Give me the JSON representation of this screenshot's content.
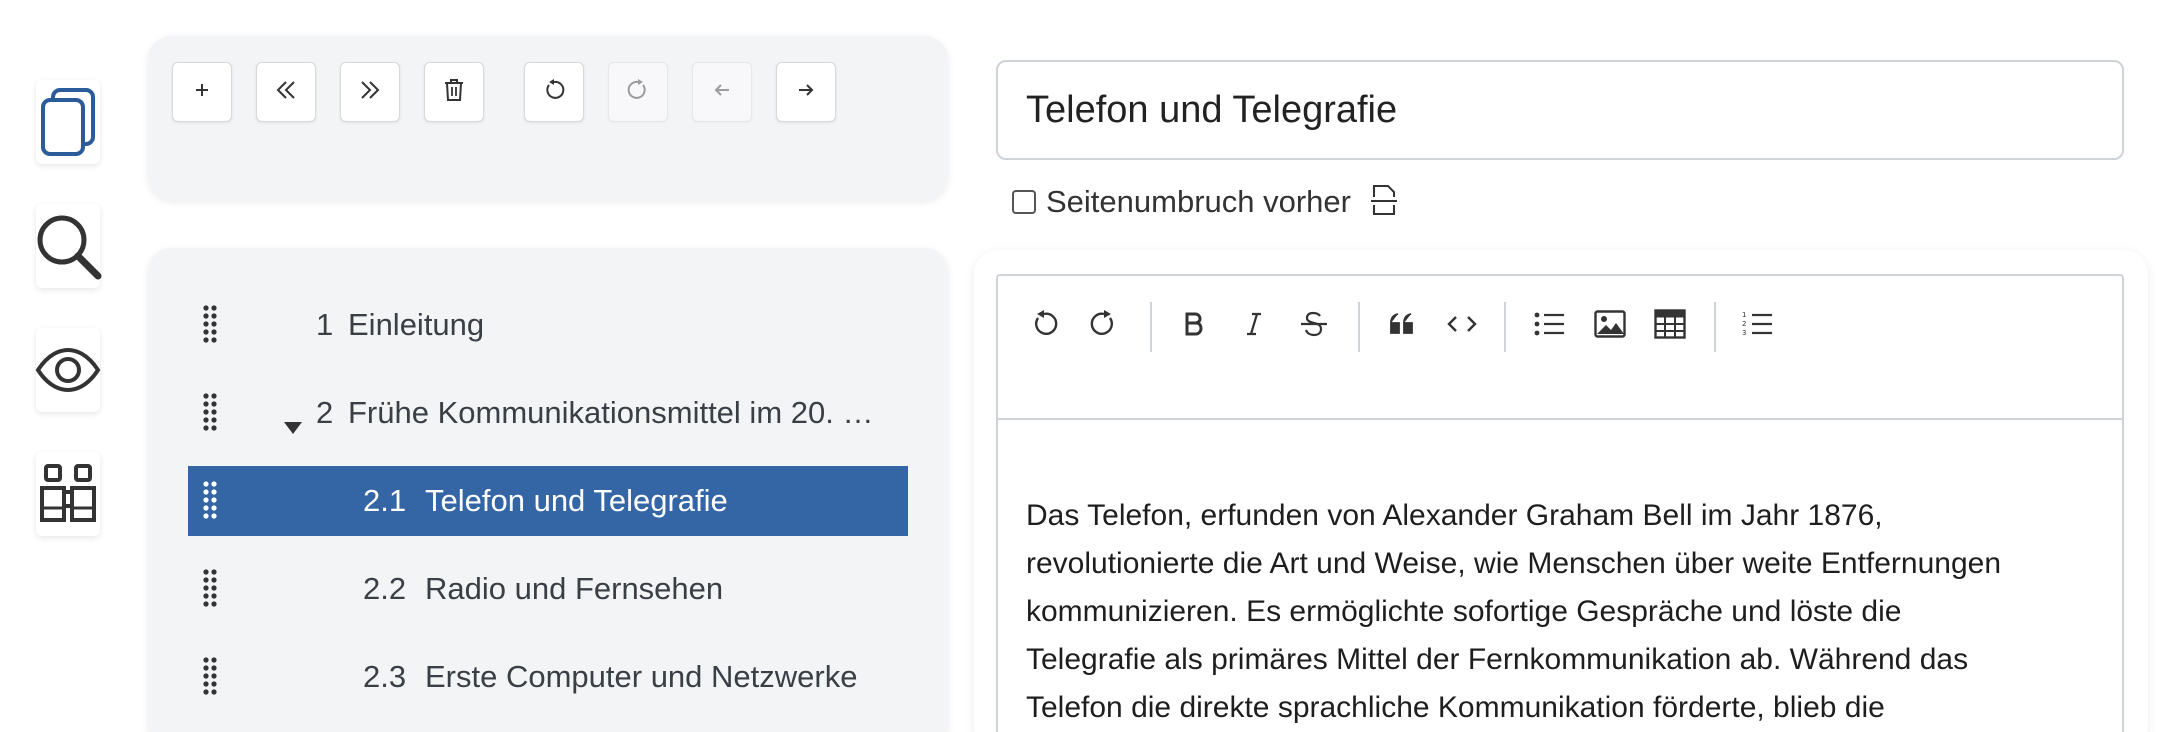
{
  "rail": {
    "items": [
      {
        "icon": "copy-icon"
      },
      {
        "icon": "search-icon"
      },
      {
        "icon": "eye-icon"
      },
      {
        "icon": "binoculars-icon"
      }
    ]
  },
  "toolbar": {
    "buttons": [
      {
        "icon": "plus-icon",
        "enabled": true
      },
      {
        "icon": "chevrons-left-icon",
        "enabled": true
      },
      {
        "icon": "chevrons-right-icon",
        "enabled": true
      },
      {
        "icon": "trash-icon",
        "enabled": true
      },
      {
        "icon": "undo-icon",
        "enabled": true
      },
      {
        "icon": "redo-icon",
        "enabled": false
      },
      {
        "icon": "arrow-left-icon",
        "enabled": false
      },
      {
        "icon": "arrow-right-icon",
        "enabled": true
      }
    ]
  },
  "tree": {
    "items": [
      {
        "num": "1",
        "title": "Einleitung",
        "level": 1,
        "expanded": null,
        "selected": false
      },
      {
        "num": "2",
        "title": "Frühe Kommunikationsmittel im 20. …",
        "level": 1,
        "expanded": true,
        "selected": false
      },
      {
        "num": "2.1",
        "title": "Telefon und Telegrafie",
        "level": 2,
        "expanded": null,
        "selected": true
      },
      {
        "num": "2.2",
        "title": "Radio und Fernsehen",
        "level": 2,
        "expanded": null,
        "selected": false
      },
      {
        "num": "2.3",
        "title": "Erste Computer und Netzwerke",
        "level": 2,
        "expanded": null,
        "selected": false
      }
    ]
  },
  "editor": {
    "title_value": "Telefon und Telegrafie",
    "page_break_label": "Seitenumbruch vorher",
    "page_break_checked": false,
    "toolbar_icons": [
      "undo-icon",
      "redo-icon",
      "bold-icon",
      "italic-icon",
      "strikethrough-icon",
      "quote-icon",
      "code-icon",
      "bullet-list-icon",
      "image-icon",
      "table-icon",
      "numbered-list-icon"
    ],
    "content_lines": [
      "Das Telefon, erfunden von Alexander Graham Bell im Jahr 1876,",
      "revolutionierte die Art und Weise, wie Menschen über weite Entfernungen",
      "kommunizieren. Es ermöglichte sofortige Gespräche und löste die",
      "Telegrafie als primäres Mittel der Fernkommunikation ab. Während das",
      "Telefon die direkte sprachliche Kommunikation förderte, blieb die"
    ]
  },
  "colors": {
    "selected_row": "#3465a4",
    "panel_bg": "#f3f4f6",
    "rail_icon": "#2c5b9a"
  }
}
